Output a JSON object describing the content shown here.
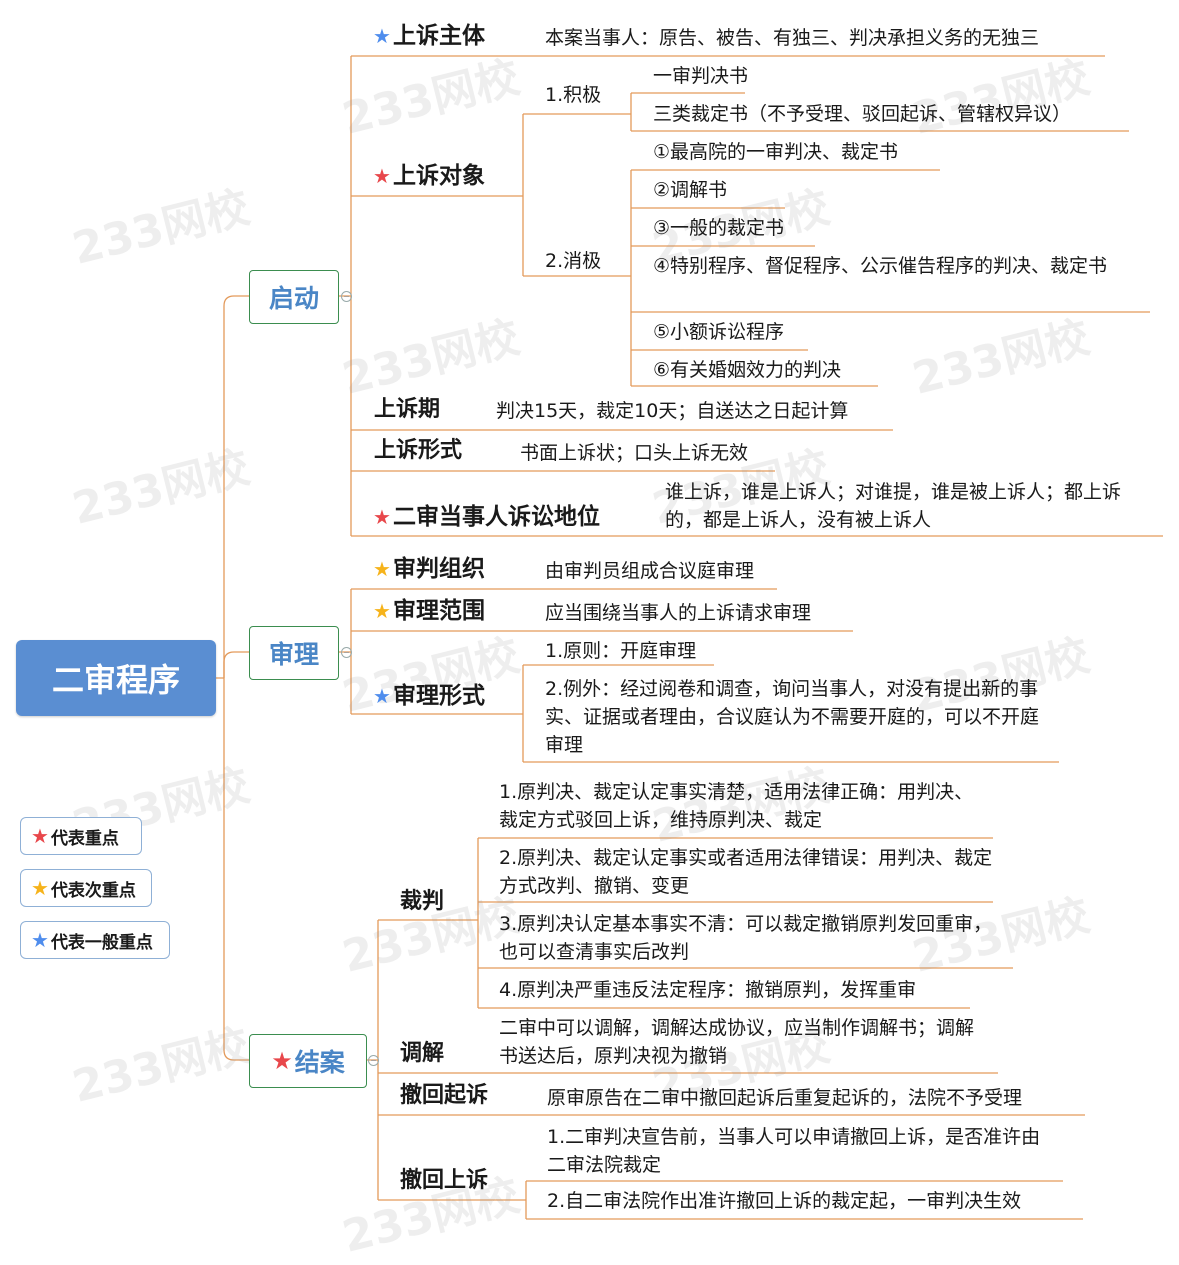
{
  "root": "二审程序",
  "watermark": "233网校",
  "legend": [
    {
      "star_color": "#e8474b",
      "label": "代表重点"
    },
    {
      "star_color": "#f6b31b",
      "label": "代表次重点"
    },
    {
      "star_color": "#4f8ded",
      "label": "代表一般重点"
    }
  ],
  "star_glyph": "★",
  "colors": {
    "line": "#e39a5b",
    "root": "#5a8ed2",
    "branch_text": "#4a86c6",
    "branch_border": "#3b8d4f"
  },
  "branches": {
    "qidong": {
      "label": "启动",
      "shangsu_zhuti": {
        "label": "上诉主体",
        "text": "本案当事人：原告、被告、有独三、判决承担义务的无独三"
      },
      "shangsu_duixiang": {
        "label": "上诉对象",
        "jiji": {
          "label": "1.积极",
          "items": [
            "一审判决书",
            "三类裁定书（不予受理、驳回起诉、管辖权异议）"
          ]
        },
        "xiaoji": {
          "label": "2.消极",
          "items": [
            "①最高院的一审判决、裁定书",
            "②调解书",
            "③一般的裁定书",
            "④特别程序、督促程序、公示催告程序的判决、裁定书",
            "⑤小额诉讼程序",
            "⑥有关婚姻效力的判决"
          ]
        }
      },
      "shangsu_qi": {
        "label": "上诉期",
        "text": "判决15天，裁定10天；自送达之日起计算"
      },
      "shangsu_xingshi": {
        "label": "上诉形式",
        "text": "书面上诉状；口头上诉无效"
      },
      "diwei": {
        "label": "二审当事人诉讼地位",
        "text": "谁上诉，谁是上诉人；对谁提，谁是被上诉人；都上诉的，都是上诉人，没有被上诉人"
      }
    },
    "shenli": {
      "label": "审理",
      "zuzhi": {
        "label": "审判组织",
        "text": "由审判员组成合议庭审理"
      },
      "fanwei": {
        "label": "审理范围",
        "text": "应当围绕当事人的上诉请求审理"
      },
      "xingshi": {
        "label": "审理形式",
        "items": [
          "1.原则：开庭审理",
          "2.例外：经过阅卷和调查，询问当事人，对没有提出新的事实、证据或者理由，合议庭认为不需要开庭的，可以不开庭审理"
        ]
      }
    },
    "jiean": {
      "label": "结案",
      "caipan": {
        "label": "裁判",
        "items": [
          "1.原判决、裁定认定事实清楚，适用法律正确：用判决、裁定方式驳回上诉，维持原判决、裁定",
          "2.原判决、裁定认定事实或者适用法律错误：用判决、裁定方式改判、撤销、变更",
          "3.原判决认定基本事实不清：可以裁定撤销原判发回重审，也可以查清事实后改判",
          "4.原判决严重违反法定程序：撤销原判，发挥重审"
        ]
      },
      "tiaojie": {
        "label": "调解",
        "text": "二审中可以调解，调解达成协议，应当制作调解书；调解书送达后，原判决视为撤销"
      },
      "chehui_qisu": {
        "label": "撤回起诉",
        "text": "原审原告在二审中撤回起诉后重复起诉的，法院不予受理"
      },
      "chehui_shangsu": {
        "label": "撤回上诉",
        "items": [
          "1.二审判决宣告前，当事人可以申请撤回上诉，是否准许由二审法院裁定",
          "2.自二审法院作出准许撤回上诉的裁定起，一审判决生效"
        ]
      }
    }
  }
}
